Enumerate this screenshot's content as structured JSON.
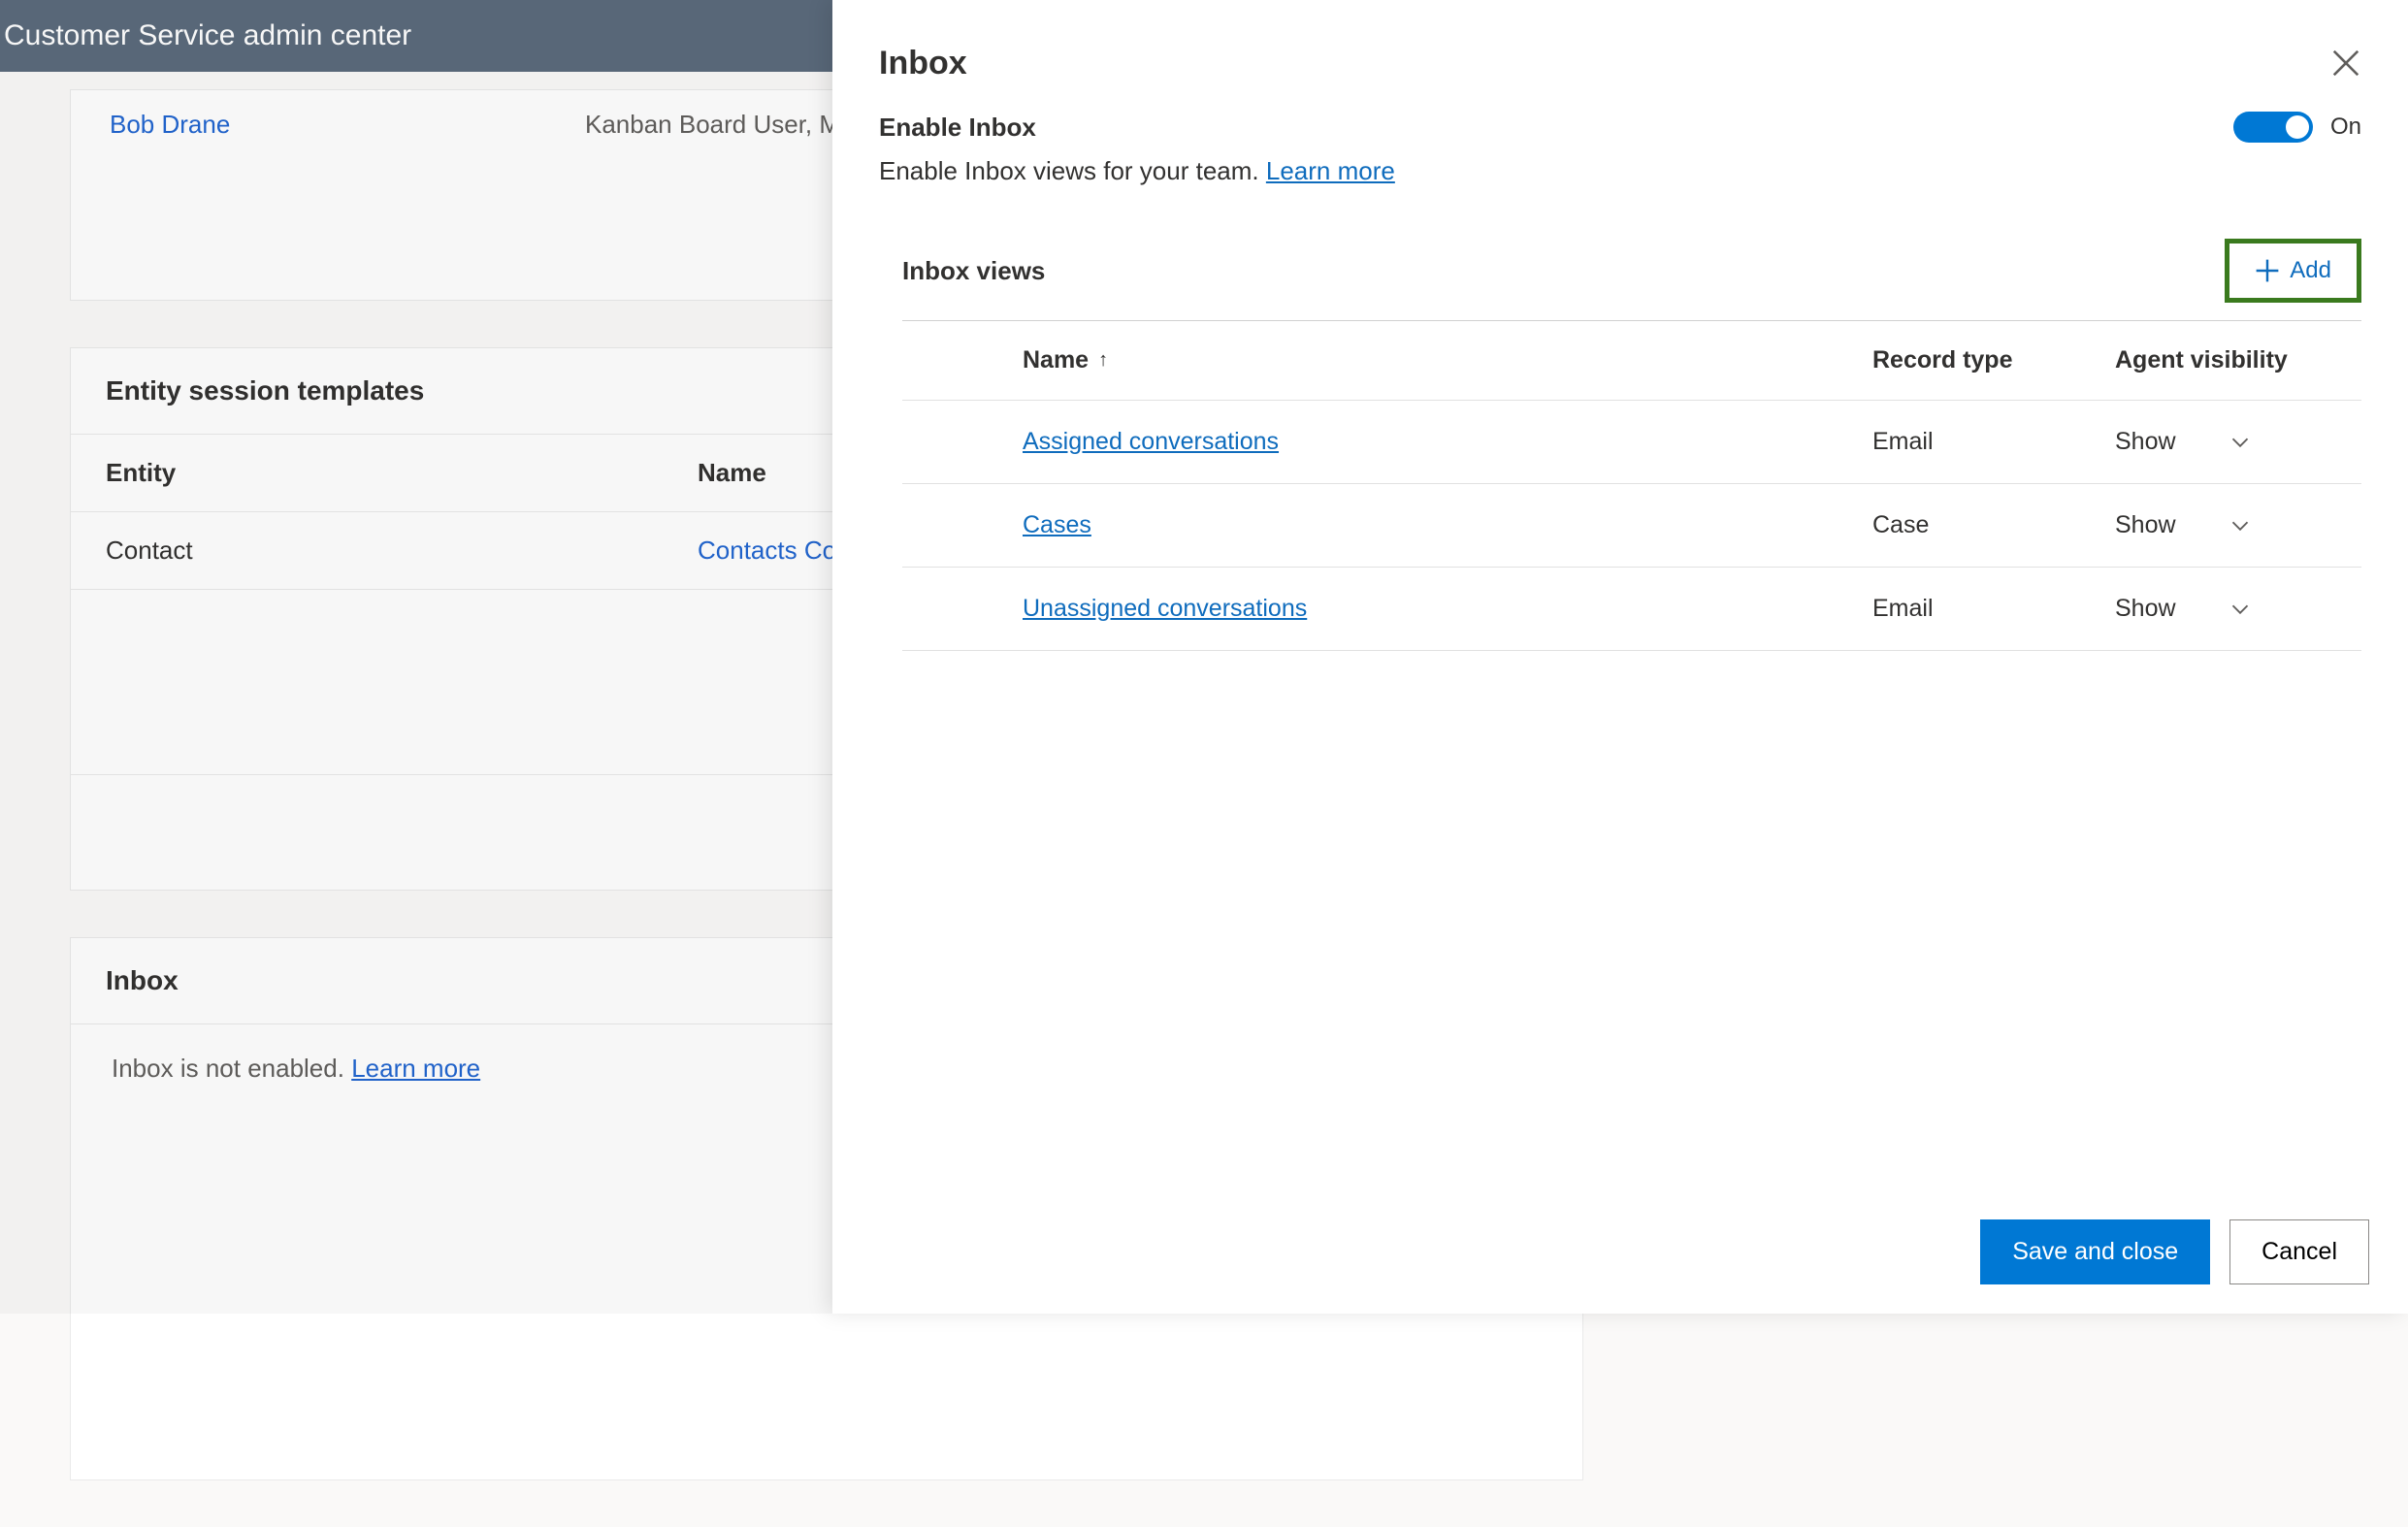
{
  "app": {
    "title": "Customer Service admin center"
  },
  "users_card": {
    "user_name": "Bob Drane",
    "user_roles": "Kanban Board User, Map"
  },
  "templates_card": {
    "title": "Entity session templates",
    "col_entity": "Entity",
    "col_name": "Name",
    "row_entity": "Contact",
    "row_name": "Contacts Co"
  },
  "inbox_card": {
    "title": "Inbox",
    "status_text": "Inbox is not enabled. ",
    "learn_more": "Learn more"
  },
  "panel": {
    "title": "Inbox",
    "enable_label": "Enable Inbox",
    "toggle_state": "On",
    "enable_desc": "Enable Inbox views for your team. ",
    "learn_more": "Learn more",
    "views_title": "Inbox views",
    "add_label": "Add",
    "col_name": "Name",
    "col_record": "Record type",
    "col_vis": "Agent visibility",
    "rows": [
      {
        "name": "Assigned conversations",
        "record": "Email",
        "vis": "Show"
      },
      {
        "name": "Cases",
        "record": "Case",
        "vis": "Show"
      },
      {
        "name": "Unassigned conversations",
        "record": "Email",
        "vis": "Show"
      }
    ],
    "save_label": "Save and close",
    "cancel_label": "Cancel"
  }
}
